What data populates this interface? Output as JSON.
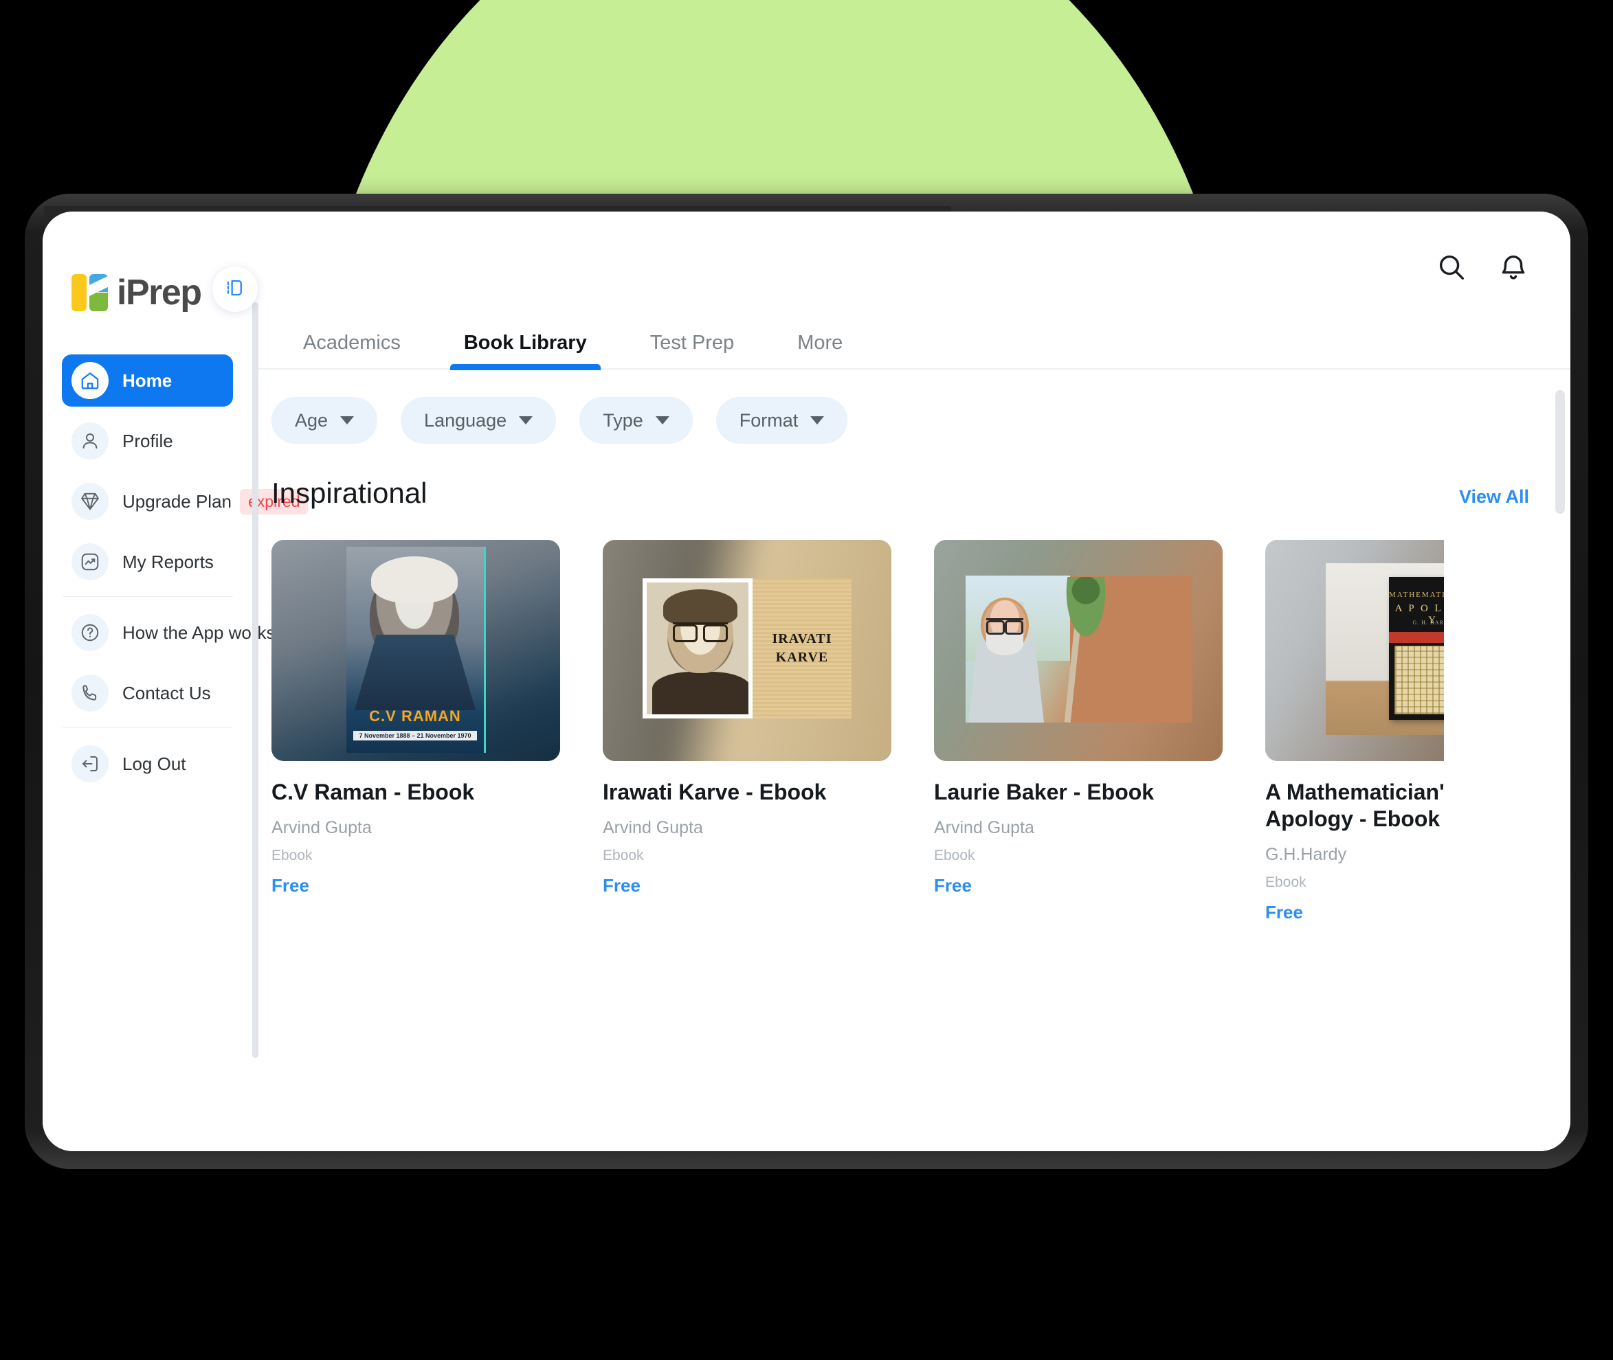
{
  "brand": {
    "name": "iPrep"
  },
  "theme": {
    "accent_blue": "#0E78F0",
    "link_blue": "#2C8DF4",
    "chip_bg": "#EAF2FB",
    "expired_red": "#F4434A",
    "backdrop_green": "#C6EF95"
  },
  "topbar": {
    "search_icon": "search-icon",
    "notifications_icon": "bell-icon"
  },
  "sidebar": {
    "collapse_toggle_icon": "panel-collapse-icon",
    "groups": [
      {
        "items": [
          {
            "label": "Home",
            "icon": "home-icon",
            "active": true
          },
          {
            "label": "Profile",
            "icon": "user-icon",
            "active": false
          },
          {
            "label": "Upgrade Plan",
            "icon": "diamond-icon",
            "active": false,
            "badge": "expired"
          },
          {
            "label": "My Reports",
            "icon": "chart-square-icon",
            "active": false
          }
        ]
      },
      {
        "items": [
          {
            "label": "How the App works",
            "icon": "question-circle-icon",
            "active": false
          },
          {
            "label": "Contact Us",
            "icon": "phone-icon",
            "active": false
          }
        ]
      },
      {
        "items": [
          {
            "label": "Log Out",
            "icon": "logout-icon",
            "active": false
          }
        ]
      }
    ]
  },
  "tabs": [
    {
      "label": "Academics",
      "active": false
    },
    {
      "label": "Book Library",
      "active": true
    },
    {
      "label": "Test Prep",
      "active": false
    },
    {
      "label": "More",
      "active": false
    }
  ],
  "filters": [
    {
      "label": "Age",
      "icon": "chevron-down-icon"
    },
    {
      "label": "Language",
      "icon": "chevron-down-icon"
    },
    {
      "label": "Type",
      "icon": "chevron-down-icon"
    },
    {
      "label": "Format",
      "icon": "chevron-down-icon"
    }
  ],
  "section": {
    "title": "Inspirational",
    "view_all_label": "View All"
  },
  "books": [
    {
      "title": "C.V Raman - Ebook",
      "author": "Arvind Gupta",
      "type": "Ebook",
      "price": "Free",
      "cover_text_name": "C.V RAMAN",
      "cover_text_dates": "7 November 1888 – 21 November 1970"
    },
    {
      "title": "Irawati Karve - Ebook",
      "author": "Arvind Gupta",
      "type": "Ebook",
      "price": "Free",
      "cover_text_line1": "IRAVATI",
      "cover_text_line2": "KARVE"
    },
    {
      "title": "Laurie Baker - Ebook",
      "author": "Arvind Gupta",
      "type": "Ebook",
      "price": "Free"
    },
    {
      "title": "A Mathematician's Apology - Ebook",
      "author": "G.H.Hardy",
      "type": "Ebook",
      "price": "Free",
      "cover_text_line1": "MATHEMATICIAN'S",
      "cover_text_line2": "A P O L O G Y",
      "cover_text_line3": "G. H. HARDY"
    }
  ]
}
